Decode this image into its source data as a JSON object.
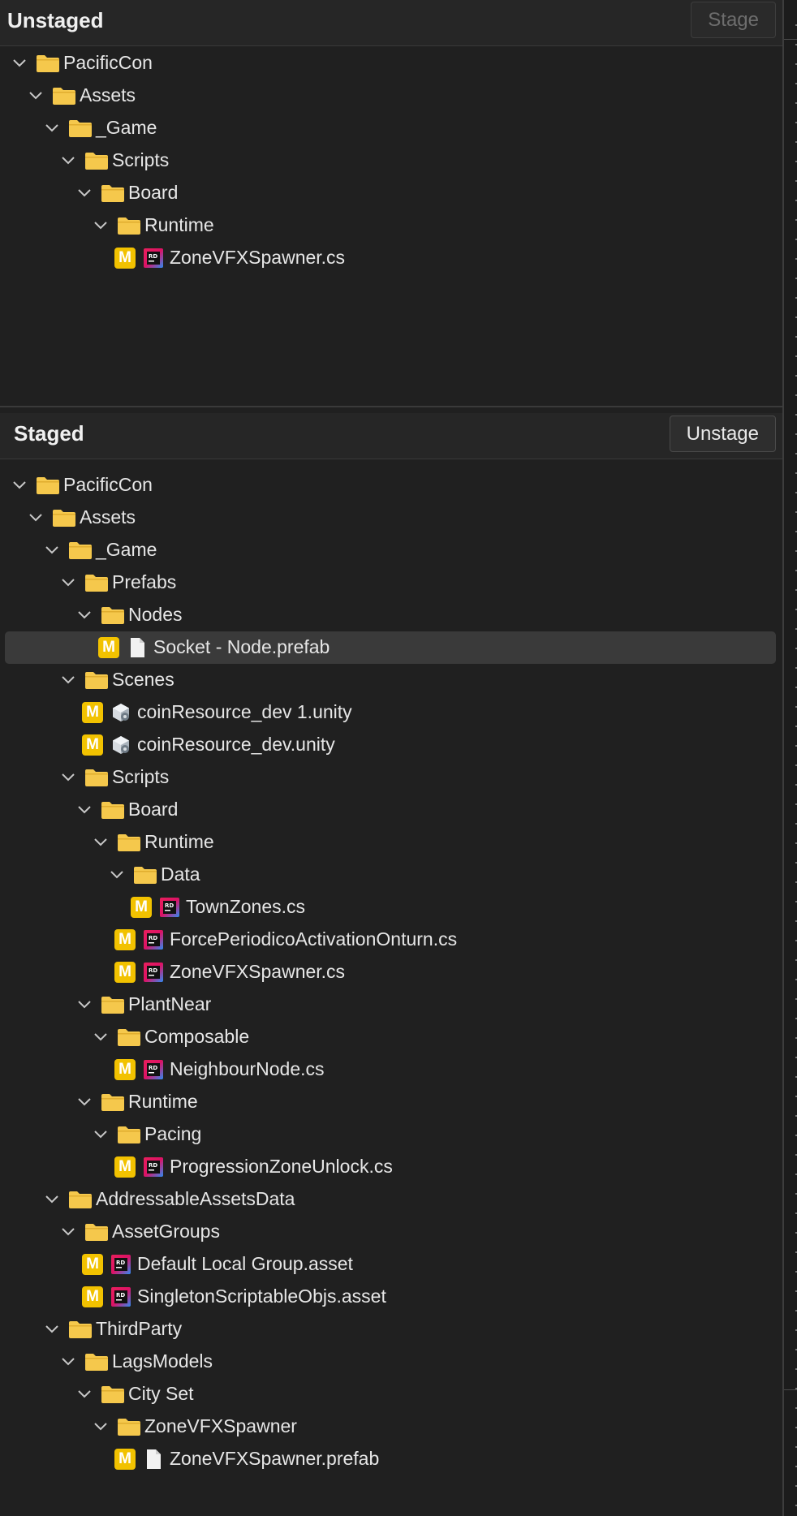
{
  "unstaged": {
    "title": "Unstaged",
    "button": "Stage",
    "items": [
      {
        "depth": 0,
        "kind": "folder",
        "label": "PacificCon"
      },
      {
        "depth": 1,
        "kind": "folder",
        "label": "Assets"
      },
      {
        "depth": 2,
        "kind": "folder",
        "label": "_Game"
      },
      {
        "depth": 3,
        "kind": "folder",
        "label": "Scripts"
      },
      {
        "depth": 4,
        "kind": "folder",
        "label": "Board"
      },
      {
        "depth": 5,
        "kind": "folder",
        "label": "Runtime"
      },
      {
        "depth": 6,
        "kind": "file",
        "status": "M",
        "icon": "rider-icon",
        "label": "ZoneVFXSpawner.cs"
      }
    ]
  },
  "staged": {
    "title": "Staged",
    "button": "Unstage",
    "items": [
      {
        "depth": 0,
        "kind": "folder",
        "label": "PacificCon"
      },
      {
        "depth": 1,
        "kind": "folder",
        "label": "Assets"
      },
      {
        "depth": 2,
        "kind": "folder",
        "label": "_Game"
      },
      {
        "depth": 3,
        "kind": "folder",
        "label": "Prefabs"
      },
      {
        "depth": 4,
        "kind": "folder",
        "label": "Nodes"
      },
      {
        "depth": 5,
        "kind": "file",
        "status": "M",
        "icon": "document-icon",
        "label": "Socket - Node.prefab",
        "selected": true
      },
      {
        "depth": 3,
        "kind": "folder",
        "label": "Scenes"
      },
      {
        "depth": 4,
        "kind": "file",
        "status": "M",
        "icon": "unity-scene-icon",
        "label": "coinResource_dev 1.unity"
      },
      {
        "depth": 4,
        "kind": "file",
        "status": "M",
        "icon": "unity-scene-icon",
        "label": "coinResource_dev.unity"
      },
      {
        "depth": 3,
        "kind": "folder",
        "label": "Scripts"
      },
      {
        "depth": 4,
        "kind": "folder",
        "label": "Board"
      },
      {
        "depth": 5,
        "kind": "folder",
        "label": "Runtime"
      },
      {
        "depth": 6,
        "kind": "folder",
        "label": "Data"
      },
      {
        "depth": 7,
        "kind": "file",
        "status": "M",
        "icon": "rider-icon",
        "label": "TownZones.cs"
      },
      {
        "depth": 6,
        "kind": "file",
        "status": "M",
        "icon": "rider-icon",
        "label": "ForcePeriodicoActivationOnturn.cs"
      },
      {
        "depth": 6,
        "kind": "file",
        "status": "M",
        "icon": "rider-icon",
        "label": "ZoneVFXSpawner.cs"
      },
      {
        "depth": 4,
        "kind": "folder",
        "label": "PlantNear"
      },
      {
        "depth": 5,
        "kind": "folder",
        "label": "Composable"
      },
      {
        "depth": 6,
        "kind": "file",
        "status": "M",
        "icon": "rider-icon",
        "label": "NeighbourNode.cs"
      },
      {
        "depth": 4,
        "kind": "folder",
        "label": "Runtime"
      },
      {
        "depth": 5,
        "kind": "folder",
        "label": "Pacing"
      },
      {
        "depth": 6,
        "kind": "file",
        "status": "M",
        "icon": "rider-icon",
        "label": "ProgressionZoneUnlock.cs"
      },
      {
        "depth": 2,
        "kind": "folder",
        "label": "AddressableAssetsData"
      },
      {
        "depth": 3,
        "kind": "folder",
        "label": "AssetGroups"
      },
      {
        "depth": 4,
        "kind": "file",
        "status": "M",
        "icon": "rider-icon",
        "label": "Default Local Group.asset"
      },
      {
        "depth": 4,
        "kind": "file",
        "status": "M",
        "icon": "rider-icon",
        "label": "SingletonScriptableObjs.asset"
      },
      {
        "depth": 2,
        "kind": "folder",
        "label": "ThirdParty"
      },
      {
        "depth": 3,
        "kind": "folder",
        "label": "LagsModels"
      },
      {
        "depth": 4,
        "kind": "folder",
        "label": "City Set"
      },
      {
        "depth": 5,
        "kind": "folder",
        "label": "ZoneVFXSpawner"
      },
      {
        "depth": 6,
        "kind": "file",
        "status": "M",
        "icon": "document-icon",
        "label": "ZoneVFXSpawner.prefab"
      }
    ]
  },
  "colors": {
    "background": "#202020",
    "folder": "#f5c84c",
    "modified_badge": "#f2c200",
    "selection": "#3a3a3a"
  }
}
